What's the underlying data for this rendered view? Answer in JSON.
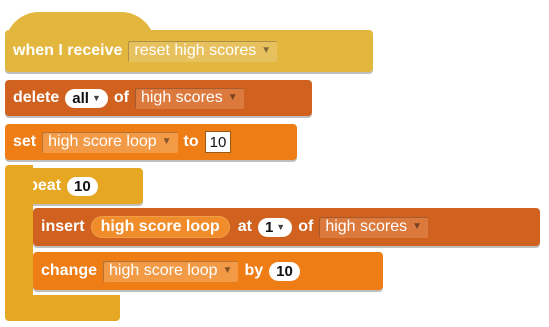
{
  "blocks": {
    "when_receive": {
      "label": "when I receive",
      "message": "reset high scores"
    },
    "delete_block": {
      "label": "delete",
      "index": "all",
      "of_label": "of",
      "list": "high scores"
    },
    "set_block": {
      "label": "set",
      "variable": "high score loop",
      "to_label": "to",
      "value": "10"
    },
    "repeat_block": {
      "label": "repeat",
      "times": "10"
    },
    "insert_block": {
      "label": "insert",
      "item": "high score loop",
      "at_label": "at",
      "index": "1",
      "of_label": "of",
      "list": "high scores"
    },
    "change_block": {
      "label": "change",
      "variable": "high score loop",
      "by_label": "by",
      "value": "10"
    }
  },
  "icons": {
    "dropdown": "dropdown-arrow-icon"
  },
  "colors": {
    "event": "#E3B73E",
    "list": "#D0611F",
    "variable": "#EE7D16",
    "control": "#E6A822"
  }
}
